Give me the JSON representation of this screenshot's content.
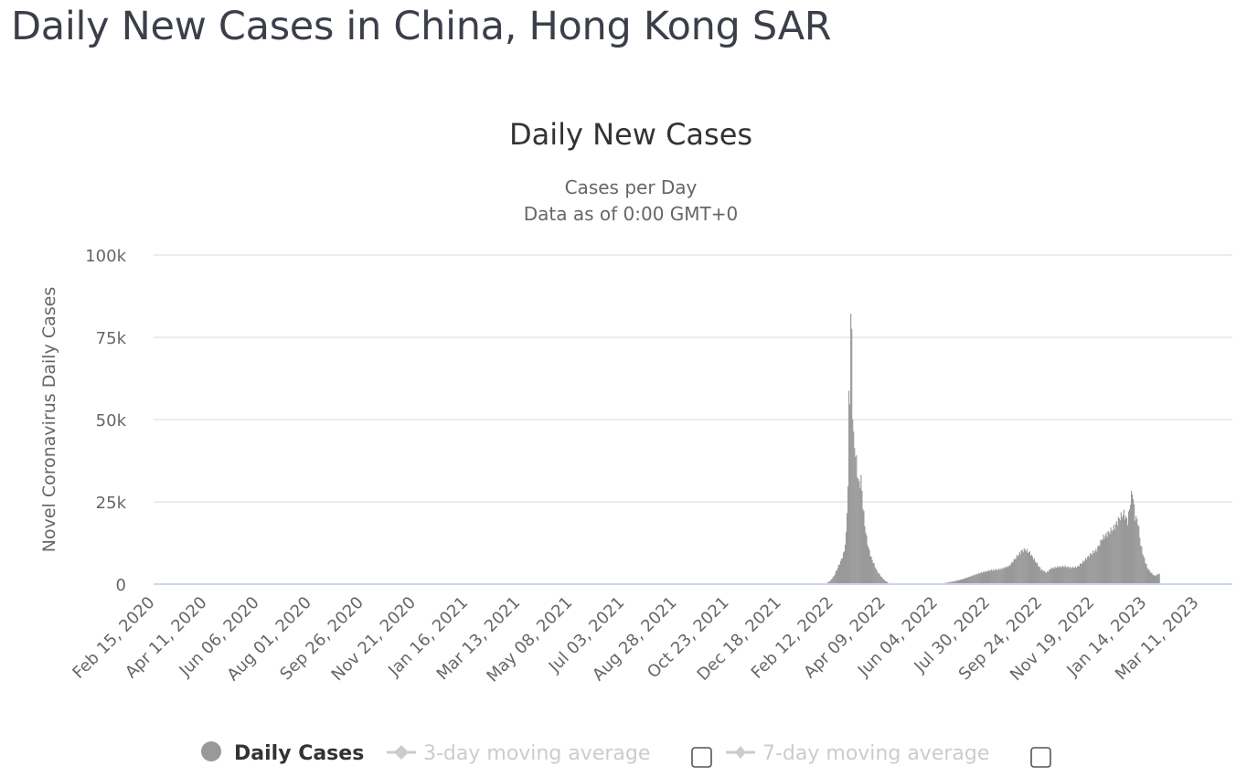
{
  "page": {
    "title": "Daily New Cases in China, Hong Kong SAR"
  },
  "chart_data": {
    "type": "bar",
    "title": "Daily New Cases",
    "subtitle_lines": [
      "Cases per Day",
      "Data as of 0:00 GMT+0"
    ],
    "xlabel": "",
    "ylabel": "Novel Coronavirus Daily Cases",
    "ylim": [
      0,
      100000
    ],
    "yticks": [
      0,
      25000,
      50000,
      75000,
      100000
    ],
    "ytick_labels": [
      "0",
      "25k",
      "50k",
      "75k",
      "100k"
    ],
    "x_range": [
      "2020-02-15",
      "2023-04-08"
    ],
    "xtick_labels": [
      "Feb 15, 2020",
      "Apr 11, 2020",
      "Jun 06, 2020",
      "Aug 01, 2020",
      "Sep 26, 2020",
      "Nov 21, 2020",
      "Jan 16, 2021",
      "Mar 13, 2021",
      "May 08, 2021",
      "Jul 03, 2021",
      "Aug 28, 2021",
      "Oct 23, 2021",
      "Dec 18, 2021",
      "Feb 12, 2022",
      "Apr 09, 2022",
      "Jun 04, 2022",
      "Jul 30, 2022",
      "Sep 24, 2022",
      "Nov 19, 2022",
      "Jan 14, 2023",
      "Mar 11, 2023"
    ],
    "xtick_dates": [
      "2020-02-15",
      "2020-04-11",
      "2020-06-06",
      "2020-08-01",
      "2020-09-26",
      "2020-11-21",
      "2021-01-16",
      "2021-03-13",
      "2021-05-08",
      "2021-07-03",
      "2021-08-28",
      "2021-10-23",
      "2021-12-18",
      "2022-02-12",
      "2022-04-09",
      "2022-06-04",
      "2022-07-30",
      "2022-09-24",
      "2022-11-19",
      "2023-01-14",
      "2023-03-11"
    ],
    "grid": true,
    "bar_color": "#999999",
    "series": [
      {
        "name": "Daily Cases",
        "points": [
          [
            "2022-02-04",
            300
          ],
          [
            "2022-02-08",
            1000
          ],
          [
            "2022-02-12",
            2500
          ],
          [
            "2022-02-16",
            5000
          ],
          [
            "2022-02-20",
            7500
          ],
          [
            "2022-02-23",
            10000
          ],
          [
            "2022-02-25",
            15000
          ],
          [
            "2022-02-27",
            30000
          ],
          [
            "2022-02-28",
            56000
          ],
          [
            "2022-03-01",
            58000
          ],
          [
            "2022-03-02",
            79900
          ],
          [
            "2022-03-03",
            76000
          ],
          [
            "2022-03-04",
            53000
          ],
          [
            "2022-03-05",
            44000
          ],
          [
            "2022-03-07",
            40000
          ],
          [
            "2022-03-09",
            34000
          ],
          [
            "2022-03-11",
            30000
          ],
          [
            "2022-03-13",
            32000
          ],
          [
            "2022-03-15",
            24000
          ],
          [
            "2022-03-17",
            18000
          ],
          [
            "2022-03-19",
            14000
          ],
          [
            "2022-03-21",
            11000
          ],
          [
            "2022-03-24",
            8000
          ],
          [
            "2022-03-27",
            6000
          ],
          [
            "2022-03-30",
            4000
          ],
          [
            "2022-04-03",
            2500
          ],
          [
            "2022-04-07",
            1200
          ],
          [
            "2022-04-11",
            400
          ],
          [
            "2022-06-10",
            300
          ],
          [
            "2022-06-20",
            800
          ],
          [
            "2022-06-30",
            1500
          ],
          [
            "2022-07-10",
            2500
          ],
          [
            "2022-07-20",
            3500
          ],
          [
            "2022-07-30",
            4200
          ],
          [
            "2022-08-09",
            4500
          ],
          [
            "2022-08-19",
            5500
          ],
          [
            "2022-08-26",
            8000
          ],
          [
            "2022-09-01",
            10000
          ],
          [
            "2022-09-05",
            10500
          ],
          [
            "2022-09-10",
            9500
          ],
          [
            "2022-09-16",
            7000
          ],
          [
            "2022-09-22",
            4500
          ],
          [
            "2022-09-28",
            3500
          ],
          [
            "2022-10-03",
            4800
          ],
          [
            "2022-10-10",
            5200
          ],
          [
            "2022-10-17",
            5400
          ],
          [
            "2022-10-24",
            5000
          ],
          [
            "2022-10-31",
            5200
          ],
          [
            "2022-11-07",
            7000
          ],
          [
            "2022-11-14",
            9000
          ],
          [
            "2022-11-21",
            10500
          ],
          [
            "2022-11-27",
            14000
          ],
          [
            "2022-12-03",
            15500
          ],
          [
            "2022-12-09",
            17000
          ],
          [
            "2022-12-15",
            20000
          ],
          [
            "2022-12-20",
            21500
          ],
          [
            "2022-12-24",
            19000
          ],
          [
            "2022-12-27",
            25000
          ],
          [
            "2022-12-29",
            28500
          ],
          [
            "2023-01-01",
            20500
          ],
          [
            "2023-01-04",
            19000
          ],
          [
            "2023-01-07",
            12000
          ],
          [
            "2023-01-10",
            8500
          ],
          [
            "2023-01-14",
            5000
          ],
          [
            "2023-01-18",
            3500
          ],
          [
            "2023-01-22",
            2500
          ],
          [
            "2023-01-27",
            3200
          ]
        ]
      }
    ],
    "legend": {
      "placement": "bottom-center",
      "items": [
        {
          "label": "Daily Cases",
          "active": true,
          "marker": "circle",
          "color": "#999999"
        },
        {
          "label": "3-day moving average",
          "active": false,
          "marker": "line-diamond",
          "color": "#cccccc",
          "checkbox_checked": false
        },
        {
          "label": "7-day moving average",
          "active": false,
          "marker": "line-diamond",
          "color": "#cccccc",
          "checkbox_checked": false
        }
      ]
    }
  }
}
